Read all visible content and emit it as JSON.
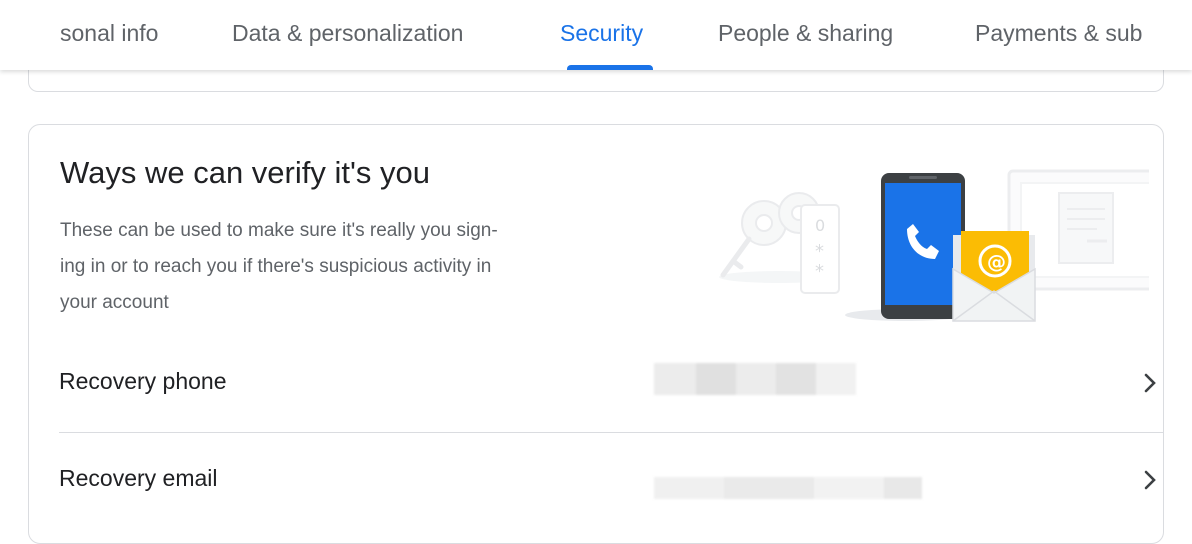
{
  "tabs": [
    {
      "label": "sonal info",
      "active": false
    },
    {
      "label": "Data & personalization",
      "active": false
    },
    {
      "label": "Security",
      "active": true
    },
    {
      "label": "People & sharing",
      "active": false
    },
    {
      "label": "Payments & sub",
      "active": false
    }
  ],
  "card": {
    "title": "Ways we can verify it's you",
    "description_lines": [
      "These can be used to make sure it's really you sign-",
      "ing in or to reach you if there's suspicious activity in",
      "your account"
    ],
    "rows": [
      {
        "label": "Recovery phone",
        "value": "",
        "icon": "chevron-right-icon"
      },
      {
        "label": "Recovery email",
        "value": "",
        "icon": "chevron-right-icon"
      }
    ]
  },
  "colors": {
    "accent": "#1a73e8",
    "text_primary": "#202124",
    "text_secondary": "#5f6368",
    "border": "#dadce0",
    "phone_blue": "#1a73e8",
    "mail_yellow": "#fbbc04"
  }
}
